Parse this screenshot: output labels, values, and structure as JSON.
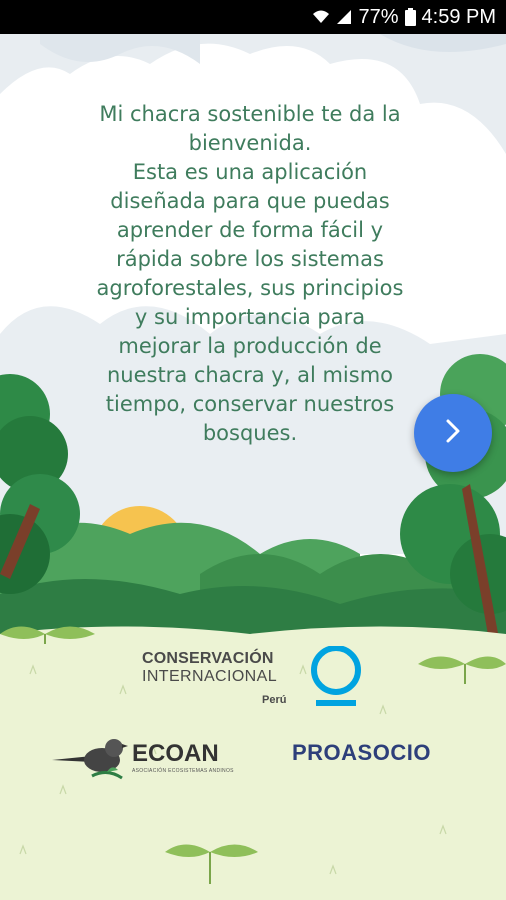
{
  "status_bar": {
    "battery": "77%",
    "time": "4:59 PM",
    "icons": [
      "wifi-icon",
      "signal-icon",
      "battery-icon"
    ]
  },
  "welcome": {
    "lines": [
      "Mi chacra sostenible te da la",
      "bienvenida.",
      "Esta es una aplicación",
      "diseñada para que puedas",
      "aprender de forma fácil y",
      "rápida sobre los sistemas",
      "agroforestales, sus principios",
      "y su importancia para",
      "mejorar la producción de",
      "nuestra chacra y, al mismo",
      "tiempo, conservar nuestros",
      "bosques."
    ]
  },
  "next_button": {
    "icon": "chevron-right-icon"
  },
  "logos": {
    "conservacion": {
      "line1": "CONSERVACIÓN",
      "line2": "INTERNACIONAL",
      "country": "Perú"
    },
    "ecoan": {
      "name": "ECOAN",
      "subtitle": "ASOCIACIÓN ECOSISTEMAS ANDINOS"
    },
    "proasocio": {
      "name": "PROASOCIO"
    }
  },
  "colors": {
    "text_green": "#3f7c5d",
    "button_blue": "#3f7de6",
    "grass": "#ecf3d4",
    "sun": "#f6c34f",
    "ci_blue": "#00a3e0"
  }
}
